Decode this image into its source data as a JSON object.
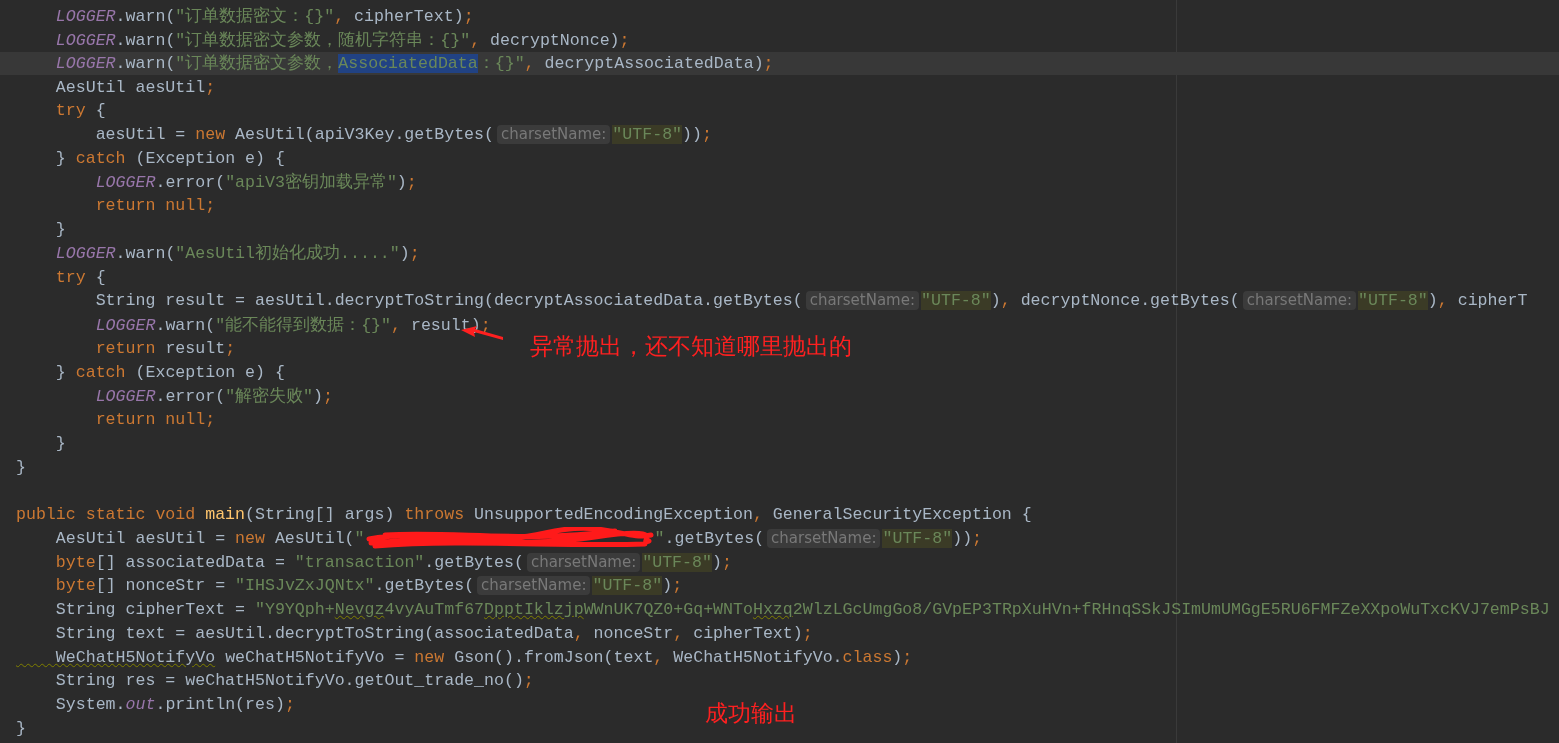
{
  "editor": {
    "lines": [
      {
        "current": false,
        "tokens": [
          {
            "kind": "static",
            "text": "    LOGGER"
          },
          {
            "kind": "plain",
            "text": ".warn("
          },
          {
            "kind": "string",
            "text": "\"订单数据密文：{}\""
          },
          {
            "kind": "punct",
            "text": ","
          },
          {
            "kind": "plain",
            "text": " cipherText)"
          },
          {
            "kind": "punct",
            "text": ";"
          }
        ]
      },
      {
        "current": false,
        "tokens": [
          {
            "kind": "static",
            "text": "    LOGGER"
          },
          {
            "kind": "plain",
            "text": ".warn("
          },
          {
            "kind": "string",
            "text": "\"订单数据密文参数，随机字符串：{}\""
          },
          {
            "kind": "punct",
            "text": ","
          },
          {
            "kind": "plain",
            "text": " decryptNonce)"
          },
          {
            "kind": "punct",
            "text": ";"
          }
        ]
      },
      {
        "current": true,
        "tokens": [
          {
            "kind": "static",
            "text": "    LOGGER"
          },
          {
            "kind": "plain",
            "text": ".warn("
          },
          {
            "kind": "string",
            "text": "\"订单数据密文参数，"
          },
          {
            "kind": "selection",
            "text": "AssociatedData"
          },
          {
            "kind": "string",
            "text": "：{}\""
          },
          {
            "kind": "punct",
            "text": ","
          },
          {
            "kind": "plain",
            "text": " decryptAssociatedData)"
          },
          {
            "kind": "punct",
            "text": ";"
          }
        ]
      },
      {
        "current": false,
        "tokens": [
          {
            "kind": "plain",
            "text": "    AesUtil aesUtil"
          },
          {
            "kind": "punct",
            "text": ";"
          }
        ]
      },
      {
        "current": false,
        "tokens": [
          {
            "kind": "keyword",
            "text": "    try"
          },
          {
            "kind": "plain",
            "text": " {"
          }
        ]
      },
      {
        "current": false,
        "tokens": [
          {
            "kind": "plain",
            "text": "        aesUtil = "
          },
          {
            "kind": "keyword",
            "text": "new"
          },
          {
            "kind": "plain",
            "text": " AesUtil(apiV3Key.getBytes("
          },
          {
            "kind": "hint",
            "text": "charsetName:"
          },
          {
            "kind": "argument",
            "text": "\"UTF-8\""
          },
          {
            "kind": "plain",
            "text": "))"
          },
          {
            "kind": "punct",
            "text": ";"
          }
        ]
      },
      {
        "current": false,
        "tokens": [
          {
            "kind": "plain",
            "text": "    } "
          },
          {
            "kind": "keyword",
            "text": "catch"
          },
          {
            "kind": "plain",
            "text": " (Exception e) {"
          }
        ]
      },
      {
        "current": false,
        "tokens": [
          {
            "kind": "static",
            "text": "        LOGGER"
          },
          {
            "kind": "plain",
            "text": ".error("
          },
          {
            "kind": "string",
            "text": "\"apiV3密钥加载异常\""
          },
          {
            "kind": "plain",
            "text": ")"
          },
          {
            "kind": "punct",
            "text": ";"
          }
        ]
      },
      {
        "current": false,
        "tokens": [
          {
            "kind": "keyword",
            "text": "        return null;"
          }
        ]
      },
      {
        "current": false,
        "tokens": [
          {
            "kind": "plain",
            "text": "    }"
          }
        ]
      },
      {
        "current": false,
        "tokens": [
          {
            "kind": "static",
            "text": "    LOGGER"
          },
          {
            "kind": "plain",
            "text": ".warn("
          },
          {
            "kind": "string",
            "text": "\"AesUtil初始化成功.....\""
          },
          {
            "kind": "plain",
            "text": ")"
          },
          {
            "kind": "punct",
            "text": ";"
          }
        ]
      },
      {
        "current": false,
        "tokens": [
          {
            "kind": "keyword",
            "text": "    try"
          },
          {
            "kind": "plain",
            "text": " {"
          }
        ]
      },
      {
        "current": false,
        "tokens": [
          {
            "kind": "plain",
            "text": "        String result = aesUtil.decryptToString(decryptAssociatedData.getBytes("
          },
          {
            "kind": "hint",
            "text": "charsetName:"
          },
          {
            "kind": "argument",
            "text": "\"UTF-8\""
          },
          {
            "kind": "plain",
            "text": ")"
          },
          {
            "kind": "punct",
            "text": ","
          },
          {
            "kind": "plain",
            "text": " decryptNonce.getBytes("
          },
          {
            "kind": "hint",
            "text": "charsetName:"
          },
          {
            "kind": "argument",
            "text": "\"UTF-8\""
          },
          {
            "kind": "plain",
            "text": ")"
          },
          {
            "kind": "punct",
            "text": ","
          },
          {
            "kind": "plain",
            "text": " cipherT"
          }
        ]
      },
      {
        "current": false,
        "tokens": [
          {
            "kind": "static",
            "text": "        LOGGER"
          },
          {
            "kind": "plain",
            "text": ".warn("
          },
          {
            "kind": "string",
            "text": "\"能不能得到数据：{}\""
          },
          {
            "kind": "punct",
            "text": ","
          },
          {
            "kind": "plain",
            "text": " result)"
          },
          {
            "kind": "punct",
            "text": ";"
          }
        ]
      },
      {
        "current": false,
        "tokens": [
          {
            "kind": "keyword",
            "text": "        return"
          },
          {
            "kind": "plain",
            "text": " result"
          },
          {
            "kind": "punct",
            "text": ";"
          }
        ]
      },
      {
        "current": false,
        "tokens": [
          {
            "kind": "plain",
            "text": "    } "
          },
          {
            "kind": "keyword",
            "text": "catch"
          },
          {
            "kind": "plain",
            "text": " (Exception e) {"
          }
        ]
      },
      {
        "current": false,
        "tokens": [
          {
            "kind": "static",
            "text": "        LOGGER"
          },
          {
            "kind": "plain",
            "text": ".error("
          },
          {
            "kind": "string",
            "text": "\"解密失败\""
          },
          {
            "kind": "plain",
            "text": ")"
          },
          {
            "kind": "punct",
            "text": ";"
          }
        ]
      },
      {
        "current": false,
        "tokens": [
          {
            "kind": "keyword",
            "text": "        return null;"
          }
        ]
      },
      {
        "current": false,
        "tokens": [
          {
            "kind": "plain",
            "text": "    }"
          }
        ]
      },
      {
        "current": false,
        "tokens": [
          {
            "kind": "plain",
            "text": "}"
          }
        ]
      },
      {
        "current": false
      },
      {
        "current": false,
        "tokens": [
          {
            "kind": "keyword",
            "text": "public static void "
          },
          {
            "kind": "function",
            "text": "main"
          },
          {
            "kind": "plain",
            "text": "(String[] args) "
          },
          {
            "kind": "keyword",
            "text": "throws"
          },
          {
            "kind": "plain",
            "text": " UnsupportedEncodingException"
          },
          {
            "kind": "punct",
            "text": ","
          },
          {
            "kind": "plain",
            "text": " GeneralSecurityException {"
          }
        ]
      },
      {
        "current": false,
        "tokens": [
          {
            "kind": "plain",
            "text": "    AesUtil aesUtil = "
          },
          {
            "kind": "keyword",
            "text": "new"
          },
          {
            "kind": "plain",
            "text": " AesUtil("
          },
          {
            "kind": "string",
            "text": "\""
          },
          {
            "kind": "redaction"
          },
          {
            "kind": "string",
            "text": "\""
          },
          {
            "kind": "plain",
            "text": ".getBytes("
          },
          {
            "kind": "hint",
            "text": "charsetName:"
          },
          {
            "kind": "argument",
            "text": "\"UTF-8\""
          },
          {
            "kind": "plain",
            "text": "))"
          },
          {
            "kind": "punct",
            "text": ";"
          }
        ]
      },
      {
        "current": false,
        "tokens": [
          {
            "kind": "keyword",
            "text": "    byte"
          },
          {
            "kind": "plain",
            "text": "[] associatedData = "
          },
          {
            "kind": "string",
            "text": "\"transaction\""
          },
          {
            "kind": "plain",
            "text": ".getBytes("
          },
          {
            "kind": "hint",
            "text": "charsetName:"
          },
          {
            "kind": "argument",
            "text": "\"UTF-8\""
          },
          {
            "kind": "plain",
            "text": ")"
          },
          {
            "kind": "punct",
            "text": ";"
          }
        ]
      },
      {
        "current": false,
        "tokens": [
          {
            "kind": "keyword",
            "text": "    byte"
          },
          {
            "kind": "plain",
            "text": "[] nonceStr = "
          },
          {
            "kind": "string",
            "text": "\"IHSJvZxJQNtx\""
          },
          {
            "kind": "plain",
            "text": ".getBytes("
          },
          {
            "kind": "hint",
            "text": "charsetName:"
          },
          {
            "kind": "argument",
            "text": "\"UTF-8\""
          },
          {
            "kind": "plain",
            "text": ")"
          },
          {
            "kind": "punct",
            "text": ";"
          }
        ]
      },
      {
        "current": false,
        "tokens": [
          {
            "kind": "plain",
            "text": "    String cipherText = "
          },
          {
            "kind": "string",
            "text": "\"Y9YQph+"
          },
          {
            "kind": "typo",
            "text": "Nevgz"
          },
          {
            "kind": "string",
            "text": "4vyAuTmf67"
          },
          {
            "kind": "typo",
            "text": "DpptIklzjp"
          },
          {
            "kind": "string",
            "text": "WWnUK7QZ0+Gq+WNTo"
          },
          {
            "kind": "typo",
            "text": "Hxzq"
          },
          {
            "kind": "string",
            "text": "2WlzLGcUmgGo8/GVpEP3TRpXuHVn+fRHnqSSkJSImUmUMGgE5RU6FMFZeXXpoWuTxcKVJ7emPsBJ"
          }
        ]
      },
      {
        "current": false,
        "tokens": [
          {
            "kind": "plain",
            "text": "    String text = aesUtil.decryptToString(associatedData"
          },
          {
            "kind": "punct",
            "text": ","
          },
          {
            "kind": "plain",
            "text": " nonceStr"
          },
          {
            "kind": "punct",
            "text": ","
          },
          {
            "kind": "plain",
            "text": " cipherText)"
          },
          {
            "kind": "punct",
            "text": ";"
          }
        ]
      },
      {
        "current": false,
        "tokens": [
          {
            "kind": "typo-plain",
            "text": "    WeChatH5NotifyVo"
          },
          {
            "kind": "plain",
            "text": " weChatH5NotifyVo = "
          },
          {
            "kind": "keyword",
            "text": "new"
          },
          {
            "kind": "plain",
            "text": " Gson().fromJson(text"
          },
          {
            "kind": "punct",
            "text": ","
          },
          {
            "kind": "plain",
            "text": " WeChatH5NotifyVo."
          },
          {
            "kind": "keyword",
            "text": "class"
          },
          {
            "kind": "plain",
            "text": ")"
          },
          {
            "kind": "punct",
            "text": ";"
          }
        ]
      },
      {
        "current": false,
        "tokens": [
          {
            "kind": "plain",
            "text": "    String res = weChatH5NotifyVo.getOut_trade_no()"
          },
          {
            "kind": "punct",
            "text": ";"
          }
        ]
      },
      {
        "current": false,
        "tokens": [
          {
            "kind": "plain",
            "text": "    System."
          },
          {
            "kind": "static",
            "text": "out"
          },
          {
            "kind": "plain",
            "text": ".println(res)"
          },
          {
            "kind": "punct",
            "text": ";"
          }
        ]
      },
      {
        "current": false,
        "tokens": [
          {
            "kind": "plain",
            "text": "}"
          }
        ]
      }
    ]
  },
  "annotations": [
    {
      "text": "异常抛出，还不知道哪里抛出的",
      "arrow": true
    },
    {
      "text": "成功输出",
      "arrow": false
    }
  ]
}
